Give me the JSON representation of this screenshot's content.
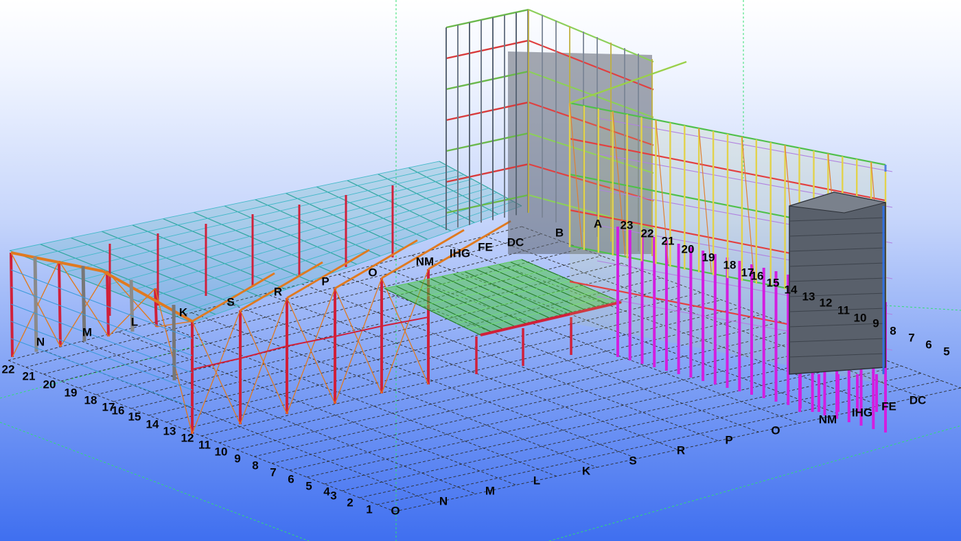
{
  "view": {
    "colors": {
      "red_member": "#d0203a",
      "orange_rafter": "#e07a20",
      "teal_roof": "#2fa59e",
      "green_floor": "#52c84a",
      "yellow_frame": "#e2d24a",
      "magenta_column": "#d21ee0",
      "blue_column": "#2f6fdf",
      "gray_block": "#5e6470",
      "grid_line": "#2a2a2a",
      "work_plane": "#2fdf6f"
    }
  },
  "grid_labels": {
    "front_row": [
      "22",
      "21",
      "20",
      "19",
      "18",
      "17",
      "16",
      "15",
      "14",
      "13",
      "12",
      "11",
      "10",
      "9",
      "8",
      "7",
      "6",
      "5",
      "4",
      "3",
      "2",
      "1"
    ],
    "front_letters": [
      "O",
      "N",
      "M",
      "L",
      "K",
      "S",
      "R",
      "P",
      "O"
    ],
    "right_letters": [
      "NM",
      "IHG",
      "FE",
      "DC"
    ],
    "right_numbers": [
      "8",
      "7",
      "6",
      "5"
    ],
    "upper_left_letters": [
      "N",
      "M",
      "L",
      "K",
      "S",
      "R",
      "P",
      "O",
      "NM",
      "IHG",
      "FE",
      "DC",
      "B",
      "A"
    ],
    "upper_numbers": [
      "23",
      "22",
      "21",
      "20",
      "19",
      "18",
      "17",
      "16",
      "15",
      "14",
      "13",
      "12",
      "11",
      "10",
      "9"
    ]
  }
}
